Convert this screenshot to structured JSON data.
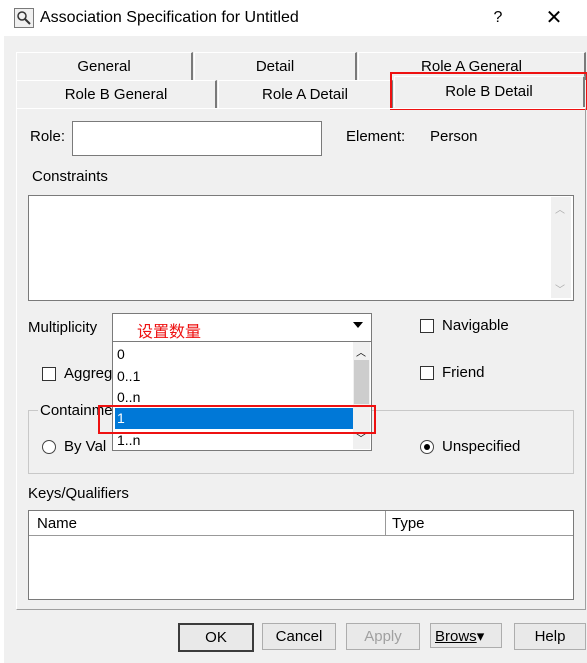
{
  "window": {
    "title": "Association Specification for Untitled",
    "help": "?",
    "close": "✕"
  },
  "tabs_row1": [
    "General",
    "Detail",
    "Role A General"
  ],
  "tabs_row2": [
    "Role B General",
    "Role A Detail",
    "Role B Detail"
  ],
  "form": {
    "role_label": "Role:",
    "role_value": "",
    "element_label": "Element:",
    "element_value": "Person",
    "constraints_label": "Constraints",
    "multiplicity_label": "Multiplicity",
    "multiplicity_value": "设置数量",
    "navigable_label": "Navigable",
    "aggregate_label": "Aggreg",
    "friend_label": "Friend",
    "containment_label": "Containme",
    "by_value_label": "By Val",
    "unspecified_label": "Unspecified",
    "keys_label": "Keys/Qualifiers",
    "keys_columns": [
      "Name",
      "Type"
    ]
  },
  "dropdown_options": [
    "0",
    "0..1",
    "0..n",
    "1",
    "1..n"
  ],
  "dropdown_selected": "1",
  "buttons": {
    "ok": "OK",
    "cancel": "Cancel",
    "apply": "Apply",
    "browse": "Brows",
    "help": "Help"
  },
  "colors": {
    "selection": "#0078d7",
    "annotation": "#e11111",
    "dialog_bg": "#f0f0f0"
  }
}
